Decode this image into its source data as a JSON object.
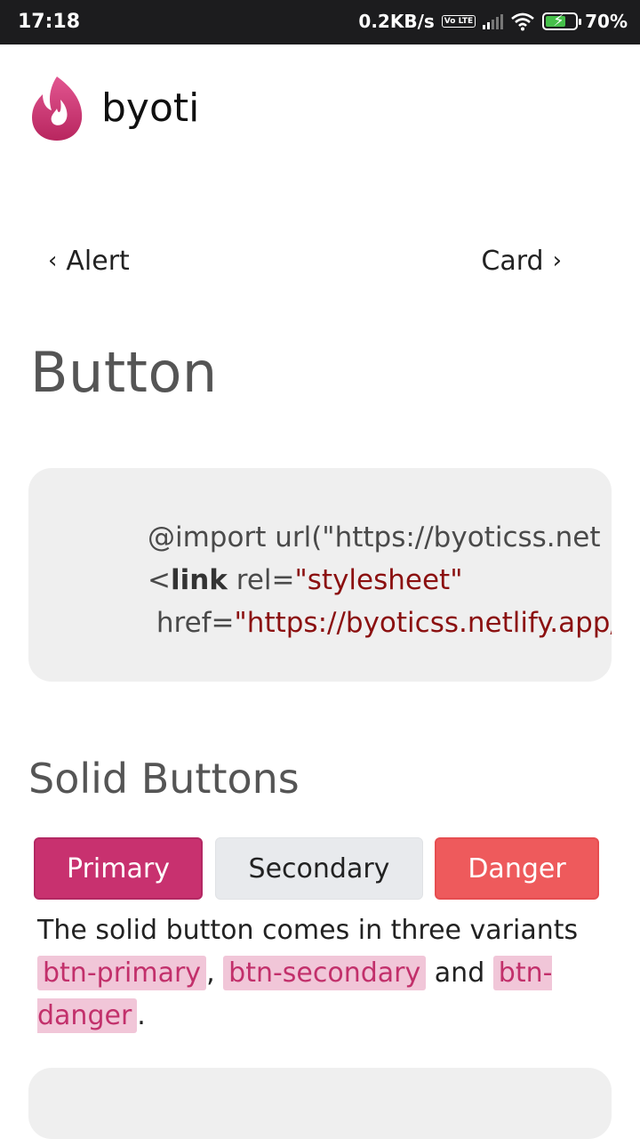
{
  "status_bar": {
    "time": "17:18",
    "network_speed": "0.2KB/s",
    "volte": "Vo LTE",
    "battery_percent": "70%",
    "battery_level": 0.7
  },
  "brand": {
    "name": "byoti",
    "logo": "flame-logo",
    "accent": "#c8316f"
  },
  "nav": {
    "prev_label": "Alert",
    "next_label": "Card"
  },
  "page": {
    "title": "Button"
  },
  "code": {
    "line1": "@import url(\"https://byoticss.net",
    "line2_open": "<",
    "line2_tag": "link",
    "line2_attr": " rel=",
    "line2_value": "\"stylesheet\"",
    "line3_attr": " href=",
    "line3_value": "\"https://byoticss.netlify.app/"
  },
  "section": {
    "title": "Solid Buttons",
    "buttons": {
      "primary": "Primary",
      "secondary": "Secondary",
      "danger": "Danger"
    },
    "description": {
      "intro": "The solid button comes in three variants",
      "class_primary": "btn-primary",
      "sep1": ",",
      "class_secondary": "btn-secondary",
      "sep2": " and ",
      "class_danger": "btn-danger",
      "end": "."
    }
  },
  "colors": {
    "primary": "#c8316f",
    "secondary": "#e8eaed",
    "danger": "#ee5a5c"
  }
}
